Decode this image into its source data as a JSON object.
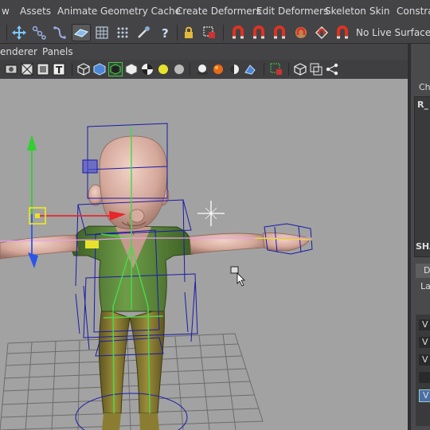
{
  "menubar": {
    "items": [
      "w",
      "Assets",
      "Animate",
      "Geometry Cache",
      "Create Deformers",
      "Edit Deformers",
      "Skeleton",
      "Skin",
      "Constrain"
    ]
  },
  "shelf": {
    "live_surface": "No Live Surface",
    "icons": [
      "move-icon",
      "joint-tool-icon",
      "ik-spline-icon",
      "smooth-bind-icon",
      "lattice-icon",
      "wrap-icon",
      "paint-weights-icon",
      "help-icon",
      "lock-icon",
      "select-object-icon",
      "snap-curve-icon",
      "snap-point-icon",
      "snap-surface-icon",
      "snap-view-icon",
      "snap-live-icon",
      "magnet-icon"
    ]
  },
  "panel_menu": {
    "renderer": "enderer",
    "panels": "Panels"
  },
  "viewport_toolbar": {
    "icons": [
      "camera-icon",
      "wireframe-icon",
      "texture-icon",
      "smooth-shade-icon",
      "wireframe-on-shaded-icon",
      "xray-icon",
      "checker-icon",
      "default-light-icon",
      "all-lights-icon",
      "shadows-icon",
      "motion-blur-icon",
      "ambient-occlusion-icon",
      "isolate-select-icon",
      "grid-icon",
      "film-gate-icon",
      "share-icon"
    ]
  },
  "right_panel": {
    "channel_box_label": "Cha",
    "object_name": "R_",
    "shapes_label": "SHA",
    "tab_label": "D",
    "layers_label": "La",
    "layer_rows": [
      "V",
      "V",
      "V",
      "",
      "V"
    ]
  },
  "colors": {
    "background": "#a2a2a2",
    "menubar": "#444446",
    "rig_wire": "#1a1aa8",
    "skin": "#d4a89b",
    "shirt": "#5e8a3c",
    "pants": "#8a7d32"
  }
}
